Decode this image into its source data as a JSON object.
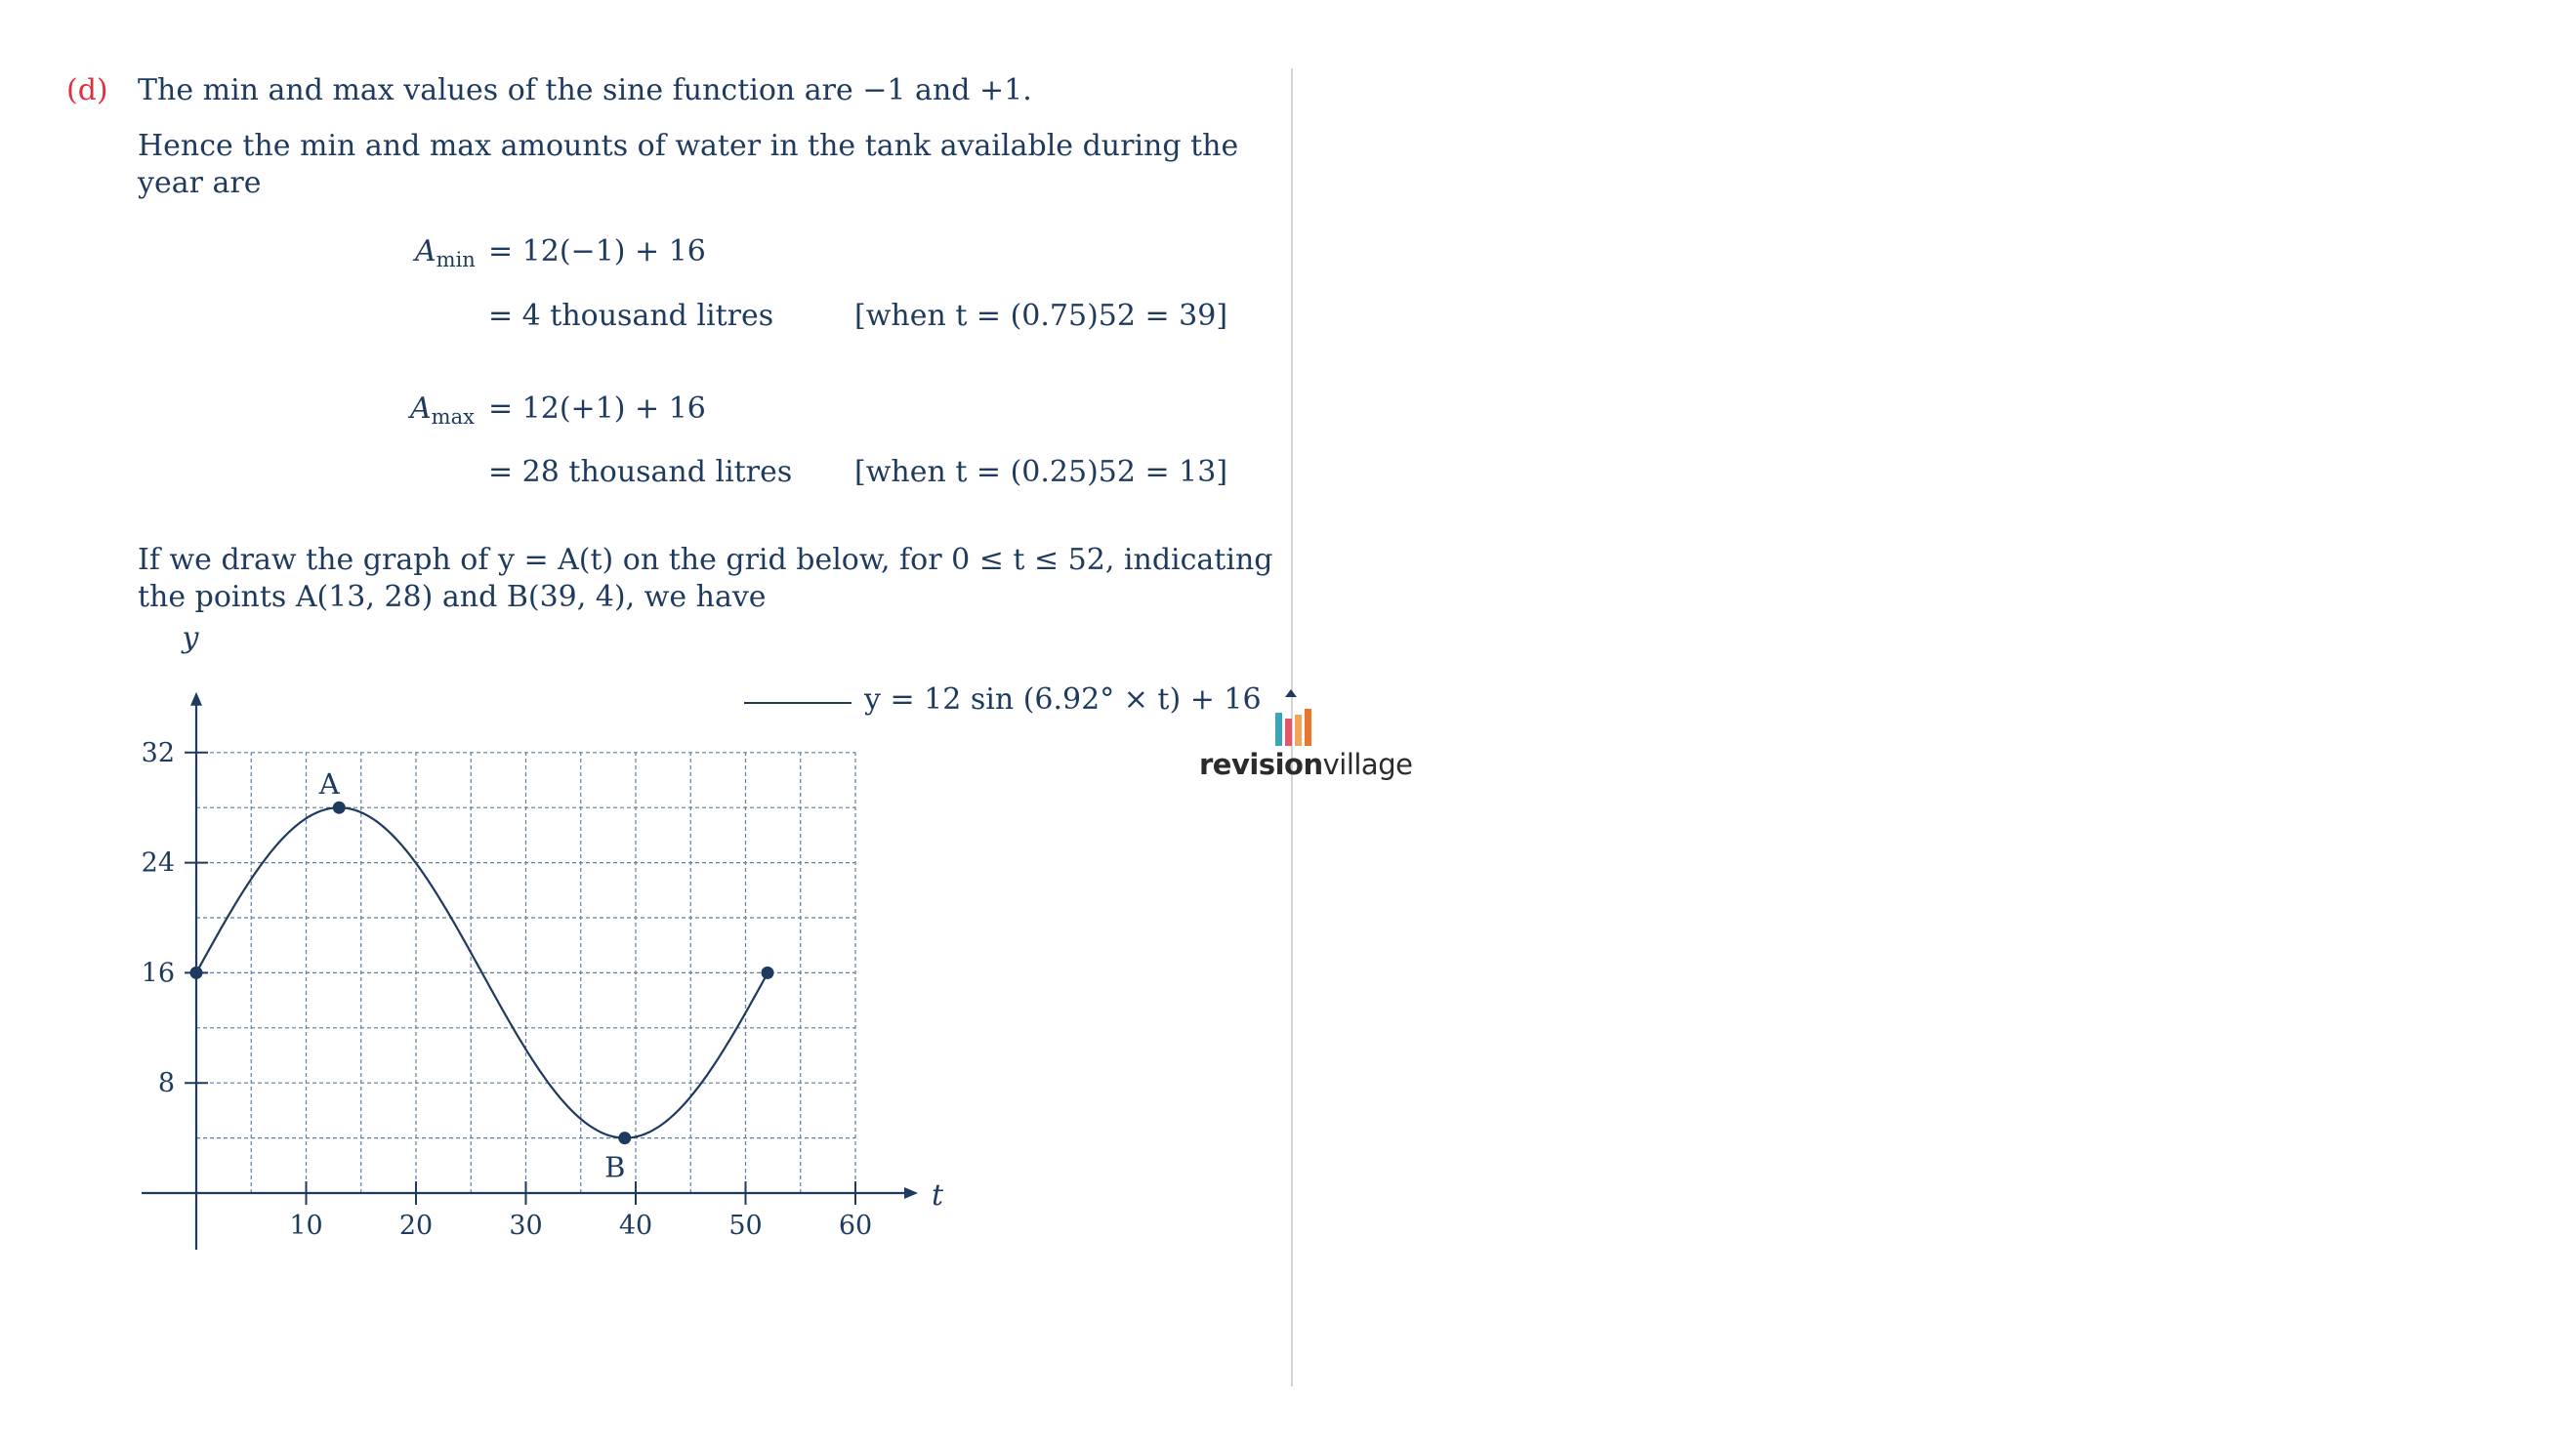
{
  "part_label": "(d)",
  "para1": "The min and max values of the sine function are −1 and +1.",
  "para2_line1": "Hence the min and max amounts of water in the tank available during the",
  "para2_line2": "year are",
  "eq_min": {
    "lhs_var": "A",
    "lhs_sub": "min",
    "line1": "= 12(−1) + 16",
    "line2": "= 4 thousand litres",
    "note": "[when t = (0.75)52 = 39]"
  },
  "eq_max": {
    "lhs_var": "A",
    "lhs_sub": "max",
    "line1": "= 12(+1) + 16",
    "line2": "= 28 thousand litres",
    "note": "[when t = (0.25)52 = 13]"
  },
  "para3_line1": "If we draw the graph of y = A(t) on the grid below, for 0 ≤ t ≤ 52, indicating",
  "para3_line2": "the points A(13, 28) and B(39, 4), we have",
  "legend_label": "y = 12 sin (6.92° × t) + 16",
  "logo": {
    "bold": "revision",
    "light": "village",
    "colors": [
      "#3aa6b9",
      "#e4566b",
      "#f2a65a",
      "#e8772e"
    ]
  },
  "chart_data": {
    "type": "line",
    "xlabel": "t",
    "ylabel": "y",
    "x_ticks": [
      10,
      20,
      30,
      40,
      50,
      60
    ],
    "y_ticks": [
      8,
      16,
      24,
      32
    ],
    "x_tick_labels": [
      "10",
      "20",
      "30",
      "40",
      "50",
      "60"
    ],
    "y_tick_labels": [
      "8",
      "16",
      "24",
      "32"
    ],
    "xlim": [
      0,
      60
    ],
    "ylim": [
      0,
      32
    ],
    "grid": true,
    "grid_x_step": 5,
    "grid_y_step": 4,
    "series": [
      {
        "name": "y = 12 sin (6.92° × t) + 16",
        "function": {
          "amplitude": 12,
          "degrees_per_unit": 6.92,
          "offset": 16,
          "t_min": 0,
          "t_max": 52
        }
      }
    ],
    "points": [
      {
        "label": "",
        "x": 0,
        "y": 16
      },
      {
        "label": "A",
        "x": 13,
        "y": 28
      },
      {
        "label": "B",
        "x": 39,
        "y": 4
      },
      {
        "label": "",
        "x": 52,
        "y": 16
      }
    ]
  }
}
